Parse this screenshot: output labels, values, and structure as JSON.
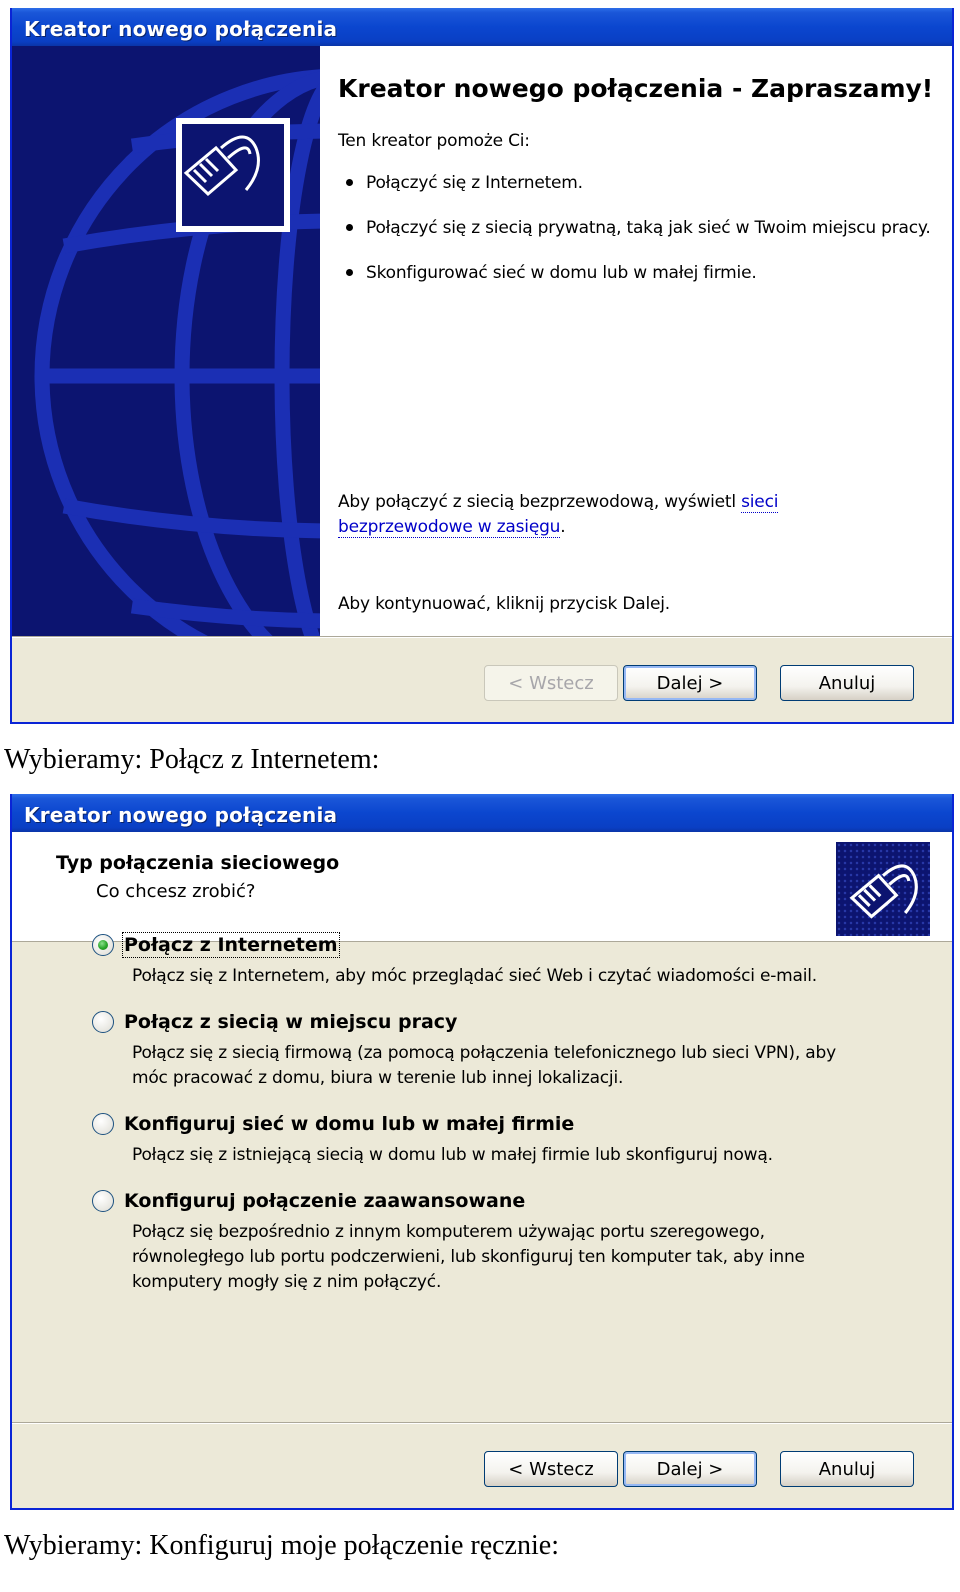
{
  "dialog1": {
    "title": "Kreator nowego połączenia",
    "heading": "Kreator nowego połączenia - Zapraszamy!",
    "intro": "Ten kreator pomoże Ci:",
    "bullets": [
      "Połączyć się z Internetem.",
      "Połączyć się z siecią prywatną, taką jak sieć w Twoim miejscu pracy.",
      "Skonfigurować sieć w domu lub w małej firmie."
    ],
    "wireless_prefix": "Aby połączyć z siecią bezprzewodową, wyświetl ",
    "wireless_link": "sieci bezprzewodowe w zasięgu",
    "wireless_suffix": ".",
    "continue_text": "Aby kontynuować, kliknij przycisk Dalej.",
    "buttons": {
      "back": "< Wstecz",
      "next": "Dalej >",
      "cancel": "Anuluj"
    }
  },
  "caption1": "Wybieramy: Połącz z Internetem:",
  "dialog2": {
    "title": "Kreator nowego połączenia",
    "header_title": "Typ połączenia sieciowego",
    "header_subtitle": "Co chcesz zrobić?",
    "options": [
      {
        "label": "Połącz z Internetem",
        "desc": "Połącz się z Internetem, aby móc przeglądać sieć Web i czytać wiadomości e-mail.",
        "selected": true
      },
      {
        "label": "Połącz z siecią w miejscu pracy",
        "desc": "Połącz się z siecią firmową (za pomocą połączenia telefonicznego lub sieci VPN), aby móc pracować z domu, biura w terenie lub innej lokalizacji.",
        "selected": false
      },
      {
        "label": "Konfiguruj sieć w domu lub w małej firmie",
        "desc": "Połącz się z istniejącą siecią w domu lub w małej firmie lub skonfiguruj nową.",
        "selected": false
      },
      {
        "label": "Konfiguruj połączenie zaawansowane",
        "desc": "Połącz się bezpośrednio z innym komputerem używając portu szeregowego, równoległego lub portu podczerwieni, lub skonfiguruj ten komputer tak, aby inne komputery mogły się z nim połączyć.",
        "selected": false
      }
    ],
    "buttons": {
      "back": "< Wstecz",
      "next": "Dalej >",
      "cancel": "Anuluj"
    }
  },
  "caption2": "Wybieramy: Konfiguruj moje połączenie ręcznie:",
  "colors": {
    "titlebar": "#0a46cf",
    "sidebar": "#0c1470",
    "globe": "#1b2fb4",
    "dialog_bg": "#ece9d8"
  },
  "icons": [
    "network-plug-icon",
    "network-plug-icon"
  ]
}
